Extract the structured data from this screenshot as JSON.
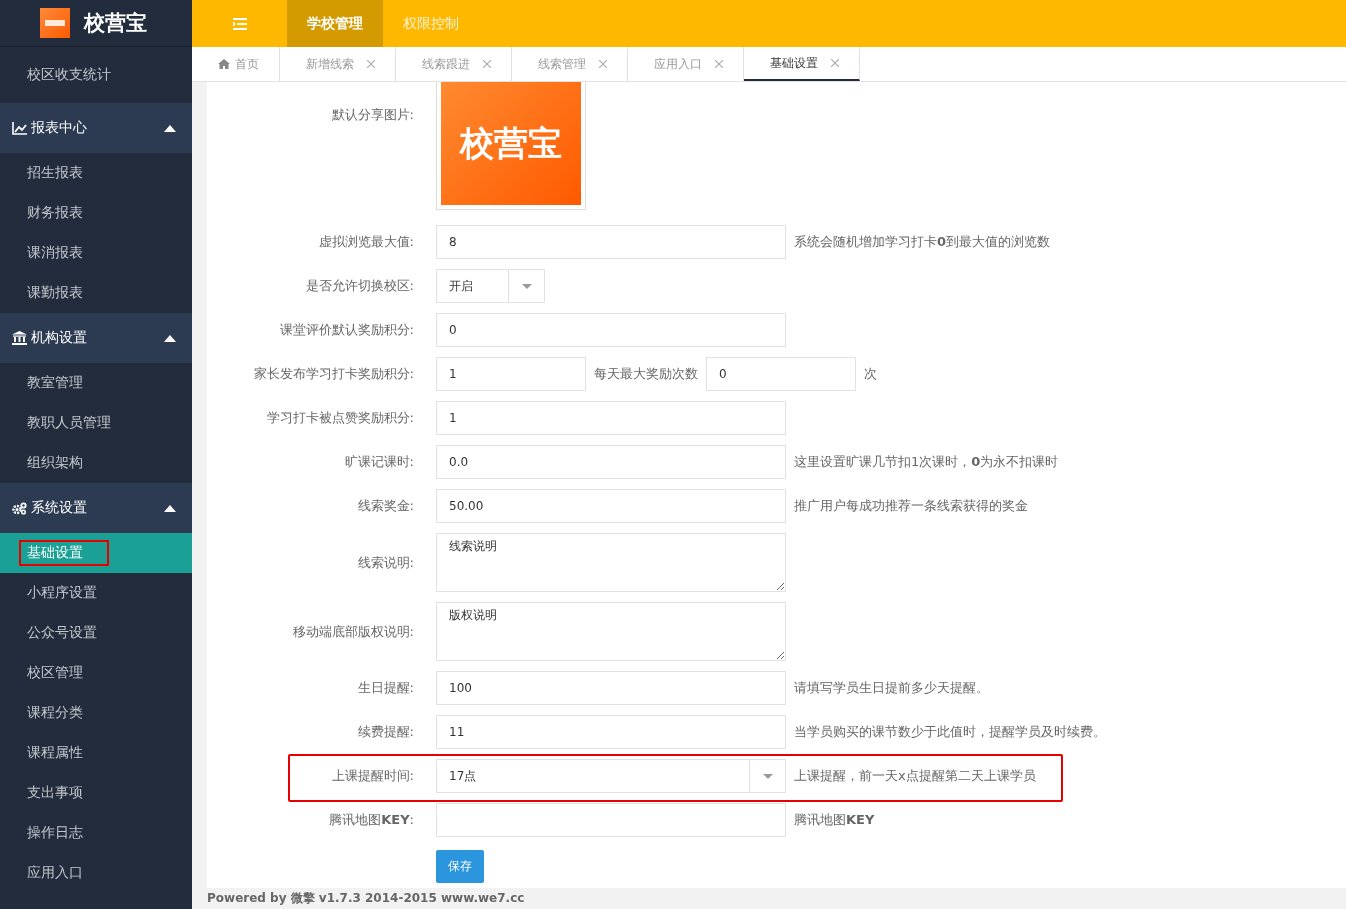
{
  "brand": {
    "name": "校营宝"
  },
  "top_nav": [
    {
      "label": "学校管理",
      "selected": true
    },
    {
      "label": "权限控制",
      "selected": false
    }
  ],
  "sidebar": {
    "items": [
      {
        "kind": "link",
        "label": "校区收支统计",
        "selected": false
      },
      {
        "kind": "group",
        "label": "报表中心",
        "expanded": true,
        "children": [
          {
            "label": "招生报表",
            "selected": false
          },
          {
            "label": "财务报表",
            "selected": false
          },
          {
            "label": "课消报表",
            "selected": false
          },
          {
            "label": "课勤报表",
            "selected": false
          }
        ]
      },
      {
        "kind": "group",
        "label": "机构设置",
        "expanded": true,
        "children": [
          {
            "label": "教室管理",
            "selected": false
          },
          {
            "label": "教职人员管理",
            "selected": false
          },
          {
            "label": "组织架构",
            "selected": false
          }
        ]
      },
      {
        "kind": "group",
        "label": "系统设置",
        "expanded": true,
        "children": [
          {
            "label": "基础设置",
            "selected": true,
            "highlighted": true
          },
          {
            "label": "小程序设置",
            "selected": false
          },
          {
            "label": "公众号设置",
            "selected": false
          },
          {
            "label": "校区管理",
            "selected": false
          },
          {
            "label": "课程分类",
            "selected": false
          },
          {
            "label": "课程属性",
            "selected": false
          },
          {
            "label": "支出事项",
            "selected": false
          },
          {
            "label": "操作日志",
            "selected": false
          },
          {
            "label": "应用入口",
            "selected": false
          }
        ]
      }
    ]
  },
  "tabs": [
    {
      "label": "首页",
      "home": true,
      "closable": false,
      "selected": false
    },
    {
      "label": "新增线索",
      "home": false,
      "closable": true,
      "selected": false
    },
    {
      "label": "线索跟进",
      "home": false,
      "closable": true,
      "selected": false
    },
    {
      "label": "线索管理",
      "home": false,
      "closable": true,
      "selected": false
    },
    {
      "label": "应用入口",
      "home": false,
      "closable": true,
      "selected": false
    },
    {
      "label": "基础设置",
      "home": false,
      "closable": true,
      "selected": true
    }
  ],
  "form": {
    "rows": [
      {
        "kind": "image",
        "label": "默认分享图片:",
        "image_text": "校营宝"
      },
      {
        "kind": "text",
        "label": "虚拟浏览最大值:",
        "value": "8",
        "help": "系统会随机增加学习打卡**0**到最大值的浏览数"
      },
      {
        "kind": "select_small",
        "label": "是否允许切换校区:",
        "value": "开启"
      },
      {
        "kind": "text",
        "label": "课堂评价默认奖励积分:",
        "value": "0"
      },
      {
        "kind": "double",
        "label": "家长发布学习打卡奖励积分:",
        "value": "1",
        "middle_label": "每天最大奖励次数",
        "value2": "0",
        "unit": "次"
      },
      {
        "kind": "text",
        "label": "学习打卡被点赞奖励积分:",
        "value": "1"
      },
      {
        "kind": "text",
        "label": "旷课记课时:",
        "value": "0.0",
        "help": "这里设置旷课几节扣1次课时，**0**为永不扣课时"
      },
      {
        "kind": "text",
        "label": "线索奖金:",
        "value": "50.00",
        "help": "推广用户每成功推荐一条线索获得的奖金"
      },
      {
        "kind": "textarea",
        "label": "线索说明:",
        "value": "线索说明"
      },
      {
        "kind": "textarea",
        "label": "移动端底部版权说明:",
        "value": "版权说明"
      },
      {
        "kind": "text",
        "label": "生日提醒:",
        "value": "100",
        "help": "请填写学员生日提前多少天提醒。"
      },
      {
        "kind": "text",
        "label": "续费提醒:",
        "value": "11",
        "help": "当学员购买的课节数少于此值时，提醒学员及时续费。"
      },
      {
        "kind": "select",
        "label": "上课提醒时间:",
        "value": "17点",
        "help": "上课提醒，前一天x点提醒第二天上课学员",
        "highlighted": true
      },
      {
        "kind": "text",
        "label": "腾讯地图**KEY**:",
        "value": "",
        "help": "腾讯地图**KEY**"
      },
      {
        "kind": "button",
        "label": "保存"
      }
    ]
  },
  "footer": "Powered by 微擎 v1.7.3 2014-2015 www.we7.cc"
}
